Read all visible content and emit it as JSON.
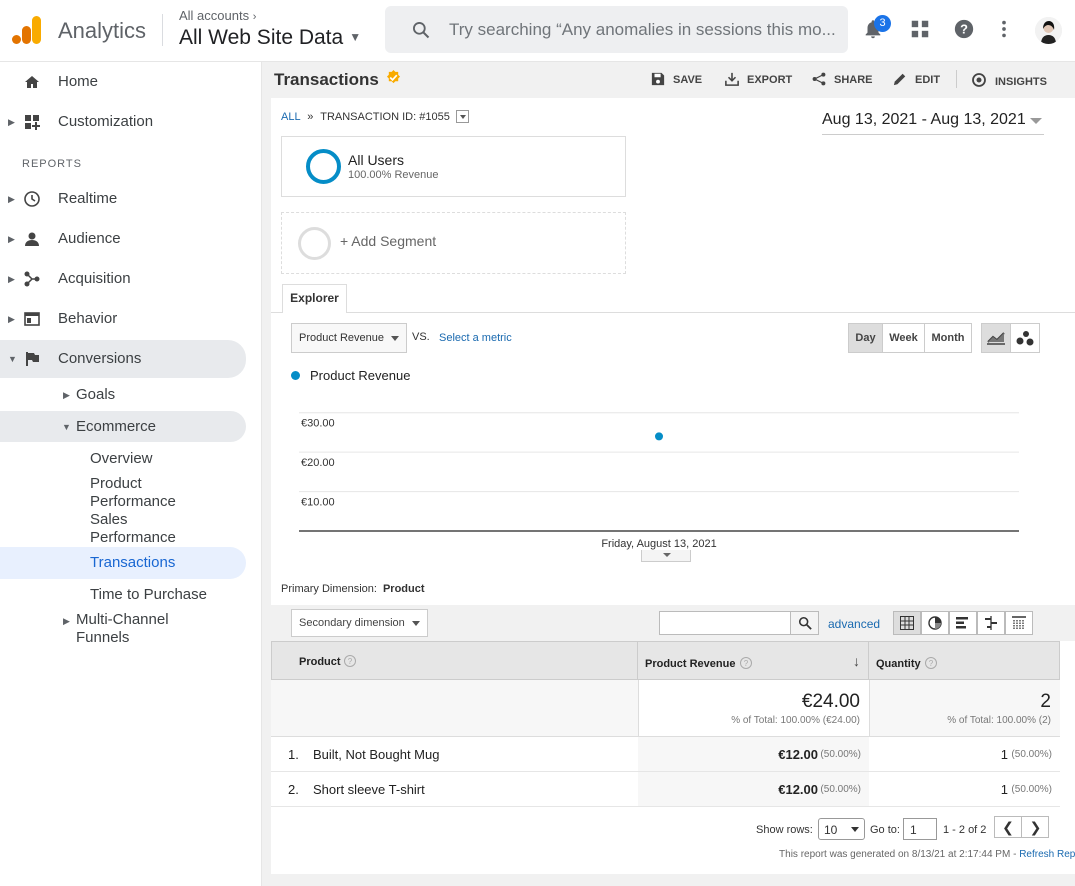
{
  "app": {
    "brand": "Analytics",
    "accounts_label": "All accounts",
    "property": "All Web Site Data",
    "search_placeholder": "Try searching “Any anomalies in sessions this mo...",
    "notifications_count": "3",
    "accent_color": "#1a73e8",
    "icons": [
      "analytics-logo-icon",
      "search-icon",
      "bell-icon",
      "apps-grid-icon",
      "help-icon",
      "more-vert-icon"
    ]
  },
  "sidebar": {
    "home": "Home",
    "customization": "Customization",
    "reports_header": "REPORTS",
    "realtime": "Realtime",
    "audience": "Audience",
    "acquisition": "Acquisition",
    "behavior": "Behavior",
    "conversions": "Conversions",
    "goals": "Goals",
    "ecommerce": "Ecommerce",
    "overview": "Overview",
    "product_performance": "Product Performance",
    "sales_performance": "Sales Performance",
    "transactions": "Transactions",
    "time_to_purchase": "Time to Purchase",
    "multichannel": "Multi-Channel Funnels"
  },
  "page": {
    "title": "Transactions",
    "actions": {
      "save": "SAVE",
      "export": "EXPORT",
      "share": "SHARE",
      "edit": "EDIT",
      "insights": "INSIGHTS"
    },
    "breadcrumb_all": "ALL",
    "breadcrumb_sep": "»",
    "breadcrumb_id": "TRANSACTION ID: #1055",
    "date_range": "Aug 13, 2021 - Aug 13, 2021"
  },
  "segments": {
    "active_name": "All Users",
    "active_pct": "100.00% Revenue",
    "add": "+ Add Segment"
  },
  "explorer": {
    "tab": "Explorer",
    "metric": "Product Revenue",
    "vs": "VS.",
    "select_metric": "Select a metric",
    "day": "Day",
    "week": "Week",
    "month": "Month"
  },
  "chart_data": {
    "type": "line",
    "series": [
      {
        "name": "Product Revenue",
        "x": [
          "Friday, August 13, 2021"
        ],
        "values": [
          24.0
        ]
      }
    ],
    "yticks": [
      "€30.00",
      "€20.00",
      "€10.00"
    ],
    "yvalues": [
      30,
      20,
      10
    ],
    "ylim": [
      0,
      35
    ],
    "x_label": "Friday, August 13, 2021",
    "color": "#058dc7",
    "grid": true
  },
  "table": {
    "primary_dimension_label": "Primary Dimension:",
    "primary_dimension": "Product",
    "secondary_dimension": "Secondary dimension",
    "advanced": "advanced",
    "headers": {
      "product": "Product",
      "revenue": "Product Revenue",
      "quantity": "Quantity"
    },
    "totals": {
      "revenue": "€24.00",
      "revenue_pct": "% of Total: 100.00% (€24.00)",
      "quantity": "2",
      "quantity_pct": "% of Total: 100.00% (2)"
    },
    "rows": [
      {
        "num": "1.",
        "product": "Built, Not Bought Mug",
        "revenue": "€12.00",
        "revenue_pct": "(50.00%)",
        "quantity": "1",
        "quantity_pct": "(50.00%)"
      },
      {
        "num": "2.",
        "product": "Short sleeve T-shirt",
        "revenue": "€12.00",
        "revenue_pct": "(50.00%)",
        "quantity": "1",
        "quantity_pct": "(50.00%)"
      }
    ],
    "show_rows_label": "Show rows:",
    "show_rows_value": "10",
    "goto_label": "Go to:",
    "goto_value": "1",
    "range": "1 - 2 of 2",
    "footer_text": "This report was generated on 8/13/21 at 2:17:44 PM - ",
    "refresh": "Refresh Report"
  }
}
